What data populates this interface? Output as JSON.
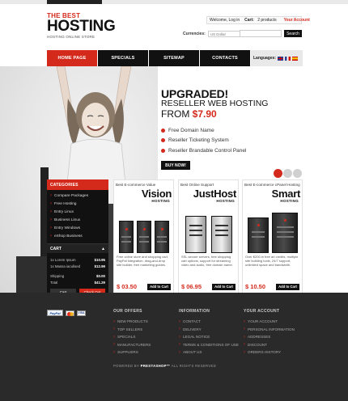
{
  "logo": {
    "line1": "THE BEST",
    "line2": "HOSTING",
    "line3": "HOSTING ONLINE STORE"
  },
  "account_bar": {
    "welcome": "Welcome, Log in",
    "cart_label": "Cart:",
    "cart_count": "2 products",
    "your_account": "Your Account"
  },
  "currency": {
    "label": "Currencies:",
    "selected": "US Dollar"
  },
  "search": {
    "placeholder": "",
    "button": "Search"
  },
  "nav": {
    "items": [
      "HOME PAGE",
      "SPECIALS",
      "SITEMAP",
      "CONTACTS"
    ],
    "languages_label": "Languages:"
  },
  "hero": {
    "title": "UPGRADED!",
    "subtitle": "RESELLER WEB HOSTING",
    "price_prefix": "FROM",
    "price": "$7.90",
    "features": [
      "Free Domain Name",
      "Reseller Ticketing System",
      "Reseller Brandable Control Panel"
    ],
    "buy_button": "BUY NOW!"
  },
  "sidebar": {
    "categories_title": "CATEGORIES",
    "categories": [
      "Compare Packages",
      "Free Hosting",
      "Entry Linux",
      "Business Linux",
      "Entry Windows",
      "eShop Business"
    ],
    "cart_title": "CART",
    "cart_items": [
      {
        "name": "1x Lorem Ipsum",
        "price": "$10.95"
      },
      {
        "name": "1x Massa iaculised",
        "price": "$12.99"
      }
    ],
    "shipping_label": "Shipping",
    "shipping_value": "$0.00",
    "total_label": "Total",
    "total_value": "$41.29",
    "cart_button": "Cart",
    "checkout_button": "Check Out"
  },
  "products": [
    {
      "tag": "Best E-commerce Value",
      "name": "Vision",
      "sub": "HOSTING",
      "desc": "Free online store and shopping cart, PayPal integration, drag-and-drop site builder, free marketing guides.",
      "price": "$ 03.50",
      "button": "Add to Cart"
    },
    {
      "tag": "Best Online Support",
      "name": "JustHost",
      "sub": "HOSTING",
      "desc": "SSL secure servers, free shopping cart options, support for streaming video and audio, free domain name.",
      "price": "$ 06.95",
      "button": "Add to Cart"
    },
    {
      "tag": "Best E-commerce cPanel Hosting",
      "name": "Smart",
      "sub": "HOSTING",
      "desc": "Over $200 in free ad credits, multiple site building tools, 24/7 support, unlimited space and bandwidth.",
      "price": "$ 10.50",
      "button": "Add to Cart"
    }
  ],
  "footer": {
    "payments": {
      "paypal": "PayPal",
      "visa": "VISA"
    },
    "offers": {
      "title": "OUR OFFERS",
      "items": [
        "NEW PRODUCTS",
        "TOP SELLERS",
        "SPECIALS",
        "MANUFACTURERS",
        "SUPPLIERS"
      ]
    },
    "information": {
      "title": "INFORMATION",
      "items": [
        "CONTACT",
        "DELIVERY",
        "LEGAL NOTICE",
        "TERMS & CONDITIONS OF USE",
        "ABOUT US"
      ]
    },
    "account": {
      "title": "YOUR ACCOUNT",
      "items": [
        "YOUR ACCOUNT",
        "PERSONAL INFORMATION",
        "ADDRESSES",
        "DISCOUNT",
        "ORDERS HISTORY"
      ]
    },
    "powered_prefix": "POWERED BY",
    "powered_brand": "PRESTASHOP™",
    "powered_suffix": "ALL RIGHTS RESERVED"
  },
  "colors": {
    "accent": "#d42a1c",
    "dark": "#111111",
    "footer": "#2a2a2a"
  }
}
